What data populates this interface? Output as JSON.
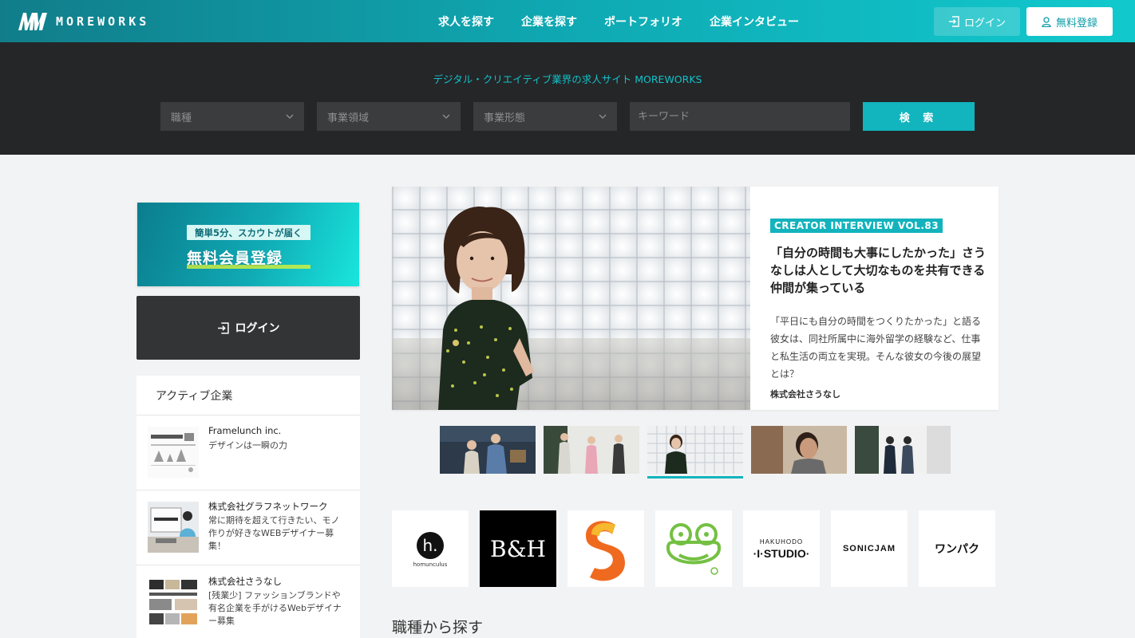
{
  "header": {
    "logo_text": "MOREWORKS",
    "nav": [
      "求人を探す",
      "企業を探す",
      "ポートフォリオ",
      "企業インタビュー"
    ],
    "login_label": "ログイン",
    "signup_label": "無料登録"
  },
  "search": {
    "tagline": "デジタル・クリエイティブ業界の求人サイト MOREWORKS",
    "selects": [
      "職種",
      "事業領域",
      "事業形態"
    ],
    "keyword_placeholder": "キーワード",
    "button_label": "検 索"
  },
  "sidebar": {
    "banner_tag": "簡単5分、スカウトが届く",
    "banner_title": "無料会員登録",
    "login_label": "ログイン",
    "active_title": "アクティブ企業",
    "companies": [
      {
        "name": "Framelunch inc.",
        "desc": "デザインは一瞬の力"
      },
      {
        "name": "株式会社グラフネットワーク",
        "desc": "常に期待を超えて行きたい、モノ作りが好きなWEBデザイナー募集！"
      },
      {
        "name": "株式会社さうなし",
        "desc": "[残業少] ファッションブランドや有名企業を手がけるWebデザイナー募集"
      }
    ]
  },
  "hero": {
    "badge": "CREATOR INTERVIEW VOL.83",
    "title": "「自分の時間も大事にしたかった」さうなしは人として大切なものを共有できる仲間が集っている",
    "desc": "「平日にも自分の時間をつくりたかった」と語る彼女は、同社所属中に海外留学の経験など、仕事と私生活の両立を実現。そんな彼女の今後の展望とは？",
    "company": "株式会社さうなし"
  },
  "logos": [
    {
      "name": "homunculus",
      "text": "homunculus"
    },
    {
      "name": "bh",
      "text": "B&H"
    },
    {
      "name": "s-logo",
      "text": ""
    },
    {
      "name": "frog",
      "text": ""
    },
    {
      "name": "hakuhodo",
      "text_top": "HAKUHODO",
      "text": "·I·STUDIO·"
    },
    {
      "name": "sonicjam",
      "text": "SONICJAM"
    },
    {
      "name": "wanpaku",
      "text": "ワンパク"
    }
  ],
  "section": {
    "title": "職種から探す"
  },
  "colors": {
    "accent": "#12b4bd",
    "dark": "#242628"
  }
}
